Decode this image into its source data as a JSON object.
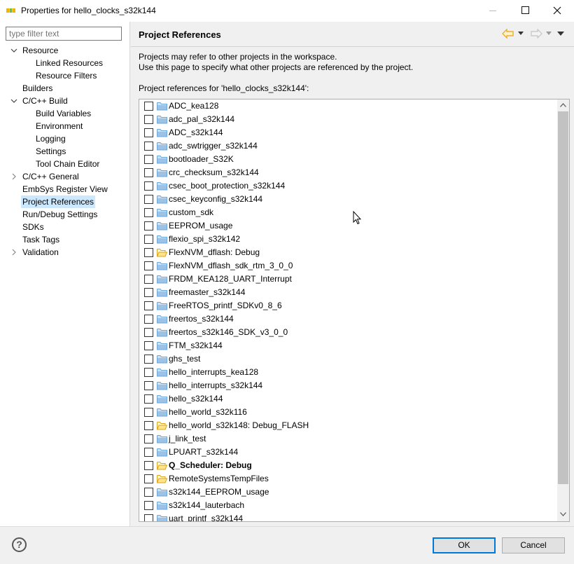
{
  "window": {
    "title": "Properties for hello_clocks_s32k144",
    "minimize_icon": "minimize-icon",
    "maximize_icon": "maximize-icon",
    "close_icon": "close-icon"
  },
  "sidebar": {
    "filter_placeholder": "type filter text",
    "items": [
      {
        "label": "Resource",
        "expand": "expanded"
      },
      {
        "label": "Linked Resources"
      },
      {
        "label": "Resource Filters"
      },
      {
        "label": "Builders"
      },
      {
        "label": "C/C++ Build",
        "expand": "expanded"
      },
      {
        "label": "Build Variables"
      },
      {
        "label": "Environment"
      },
      {
        "label": "Logging"
      },
      {
        "label": "Settings"
      },
      {
        "label": "Tool Chain Editor"
      },
      {
        "label": "C/C++ General",
        "expand": "collapsed"
      },
      {
        "label": "EmbSys Register View"
      },
      {
        "label": "Project References",
        "selected": true
      },
      {
        "label": "Run/Debug Settings"
      },
      {
        "label": "SDKs"
      },
      {
        "label": "Task Tags"
      },
      {
        "label": "Validation",
        "expand": "collapsed"
      }
    ]
  },
  "page": {
    "title": "Project References",
    "desc_line1": "Projects may refer to other projects in the workspace.",
    "desc_line2": "Use this page to specify what other projects are referenced by the project.",
    "references_label": "Project references for 'hello_clocks_s32k144':"
  },
  "projects": [
    {
      "name": "ADC_kea128",
      "icon": "folder-icon",
      "checked": false
    },
    {
      "name": "adc_pal_s32k144",
      "icon": "folder-icon",
      "checked": false
    },
    {
      "name": "ADC_s32k144",
      "icon": "folder-icon",
      "checked": false
    },
    {
      "name": "adc_swtrigger_s32k144",
      "icon": "folder-icon",
      "checked": false
    },
    {
      "name": "bootloader_S32K",
      "icon": "folder-icon",
      "checked": false
    },
    {
      "name": "crc_checksum_s32k144",
      "icon": "folder-icon",
      "checked": false
    },
    {
      "name": "csec_boot_protection_s32k144",
      "icon": "folder-icon",
      "checked": false
    },
    {
      "name": "csec_keyconfig_s32k144",
      "icon": "folder-icon",
      "checked": false
    },
    {
      "name": "custom_sdk",
      "icon": "folder-icon",
      "checked": false
    },
    {
      "name": "EEPROM_usage",
      "icon": "folder-icon",
      "checked": false
    },
    {
      "name": "flexio_spi_s32k142",
      "icon": "folder-icon",
      "checked": false
    },
    {
      "name": "FlexNVM_dflash: Debug",
      "icon": "open-folder-icon",
      "checked": false
    },
    {
      "name": "FlexNVM_dflash_sdk_rtm_3_0_0",
      "icon": "folder-icon",
      "checked": false
    },
    {
      "name": "FRDM_KEA128_UART_Interrupt",
      "icon": "folder-icon",
      "checked": false
    },
    {
      "name": "freemaster_s32k144",
      "icon": "folder-icon",
      "checked": false
    },
    {
      "name": "FreeRTOS_printf_SDKv0_8_6",
      "icon": "folder-icon",
      "checked": false
    },
    {
      "name": "freertos_s32k144",
      "icon": "folder-icon",
      "checked": false
    },
    {
      "name": "freertos_s32k146_SDK_v3_0_0",
      "icon": "folder-icon",
      "checked": false
    },
    {
      "name": "FTM_s32k144",
      "icon": "folder-icon",
      "checked": false
    },
    {
      "name": "ghs_test",
      "icon": "folder-icon",
      "checked": false
    },
    {
      "name": "hello_interrupts_kea128",
      "icon": "folder-icon",
      "checked": false
    },
    {
      "name": "hello_interrupts_s32k144",
      "icon": "folder-icon",
      "checked": false
    },
    {
      "name": "hello_s32k144",
      "icon": "folder-icon",
      "checked": false
    },
    {
      "name": "hello_world_s32k116",
      "icon": "folder-icon",
      "checked": false
    },
    {
      "name": "hello_world_s32k148: Debug_FLASH",
      "icon": "open-folder-icon",
      "checked": false
    },
    {
      "name": "j_link_test",
      "icon": "folder-icon",
      "checked": false
    },
    {
      "name": "LPUART_s32k144",
      "icon": "folder-icon",
      "checked": false
    },
    {
      "name": "Q_Scheduler: Debug",
      "icon": "open-folder-icon",
      "checked": false,
      "bold": true
    },
    {
      "name": "RemoteSystemsTempFiles",
      "icon": "open-folder-icon",
      "checked": false
    },
    {
      "name": "s32k144_EEPROM_usage",
      "icon": "folder-icon",
      "checked": false
    },
    {
      "name": "s32k144_lauterbach",
      "icon": "folder-icon",
      "checked": false
    },
    {
      "name": "uart_printf_s32k144",
      "icon": "folder-icon",
      "checked": false
    }
  ],
  "footer": {
    "help_symbol": "?",
    "ok_label": "OK",
    "cancel_label": "Cancel"
  },
  "colors": {
    "selection": "#cce8ff",
    "folder": "#6ea6d8",
    "back_arrow": "#e8a317",
    "default_button_border": "#0078d7"
  }
}
